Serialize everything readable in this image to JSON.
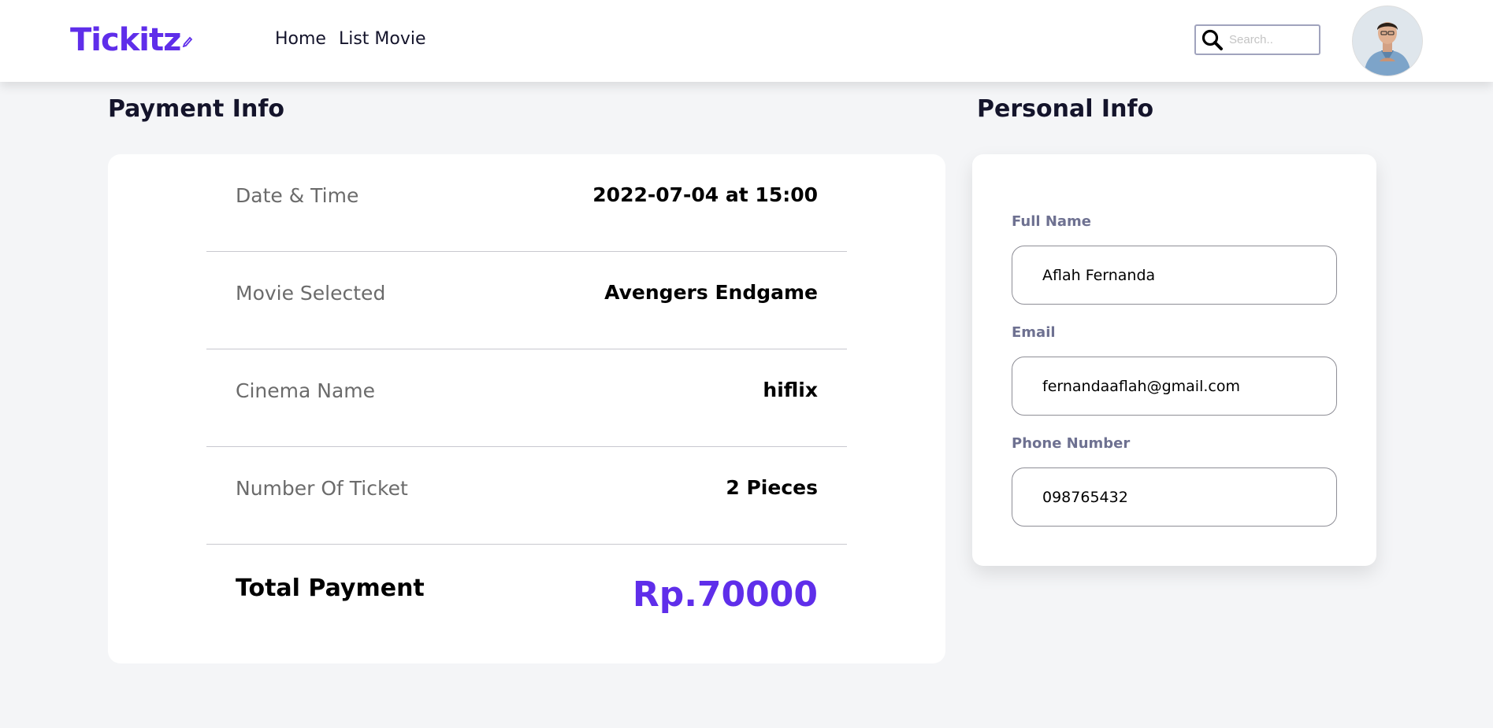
{
  "brand": {
    "logo_text": "Tickitz",
    "accent_color": "#5f2eea"
  },
  "nav": {
    "links": [
      {
        "label": "Home"
      },
      {
        "label": "List Movie"
      }
    ]
  },
  "search": {
    "placeholder": "Search..",
    "value": "",
    "icon": "search-icon"
  },
  "user": {
    "avatar": "avatar-photo"
  },
  "payment": {
    "title": "Payment Info",
    "rows": [
      {
        "label": "Date & Time",
        "value": "2022-07-04 at 15:00"
      },
      {
        "label": "Movie Selected",
        "value": "Avengers Endgame"
      },
      {
        "label": "Cinema Name",
        "value": "hiflix"
      },
      {
        "label": "Number Of Ticket",
        "value": "2 Pieces"
      }
    ],
    "total_label": "Total Payment",
    "total_value": "Rp.70000"
  },
  "personal": {
    "title": "Personal Info",
    "fields": [
      {
        "label": "Full Name",
        "value": "Aflah Fernanda"
      },
      {
        "label": "Email",
        "value": "fernandaaflah@gmail.com"
      },
      {
        "label": "Phone Number",
        "value": "098765432"
      }
    ]
  }
}
